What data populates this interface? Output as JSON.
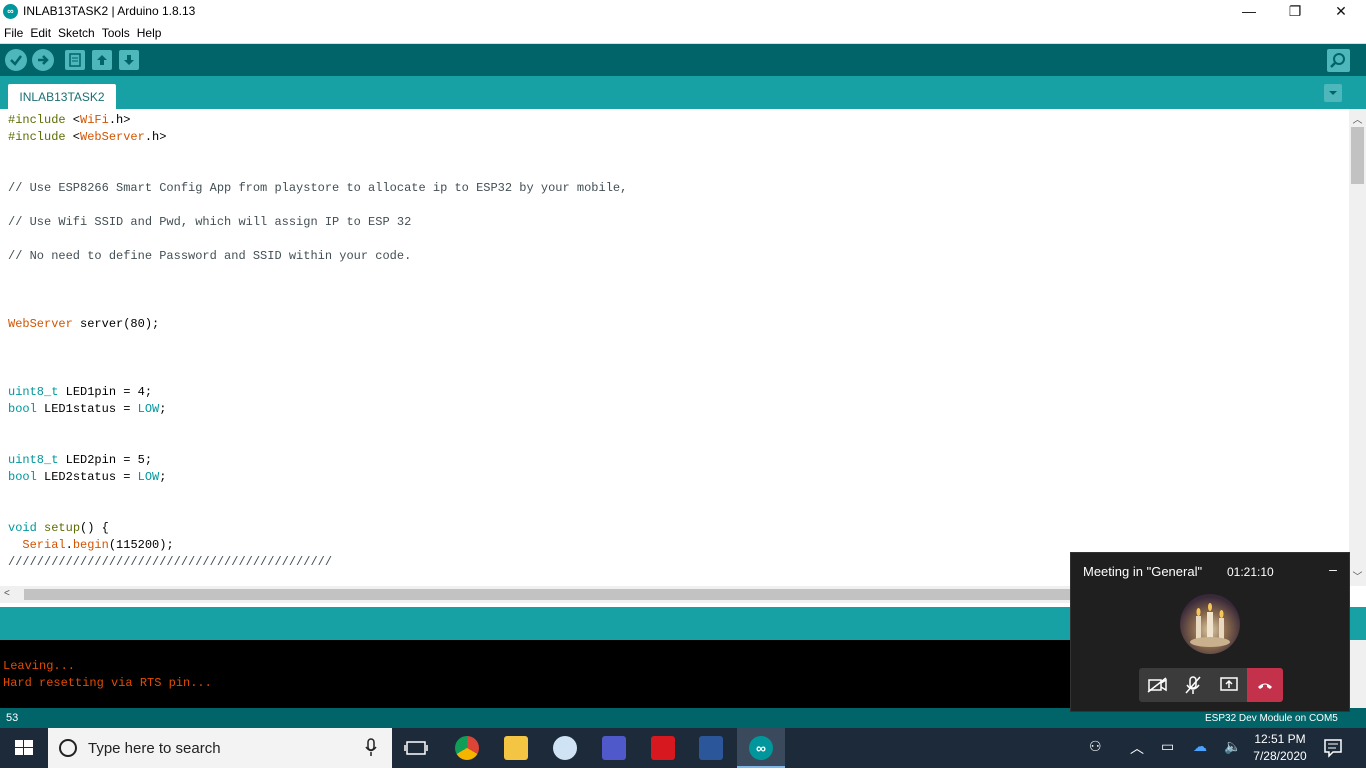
{
  "window": {
    "title": "INLAB13TASK2 | Arduino 1.8.13",
    "app_icon": "arduino-icon",
    "minimize": "—",
    "maximize": "❐",
    "close": "✕"
  },
  "menu": [
    "File",
    "Edit",
    "Sketch",
    "Tools",
    "Help"
  ],
  "toolbar": {
    "buttons": [
      "verify-icon",
      "upload-icon",
      "new-icon",
      "open-icon",
      "save-icon"
    ],
    "right": "serial-monitor-icon"
  },
  "tabs": {
    "active": "INLAB13TASK2",
    "menu_icon": "tab-menu-icon"
  },
  "editor": {
    "lines": [
      "#include <WiFi.h>",
      "#include <WebServer.h>",
      "",
      "",
      "// Use ESP8266 Smart Config App from playstore to allocate ip to ESP32 by your mobile,",
      "",
      "// Use Wifi SSID and Pwd, which will assign IP to ESP 32",
      "",
      "// No need to define Password and SSID within your code.",
      "",
      "",
      "",
      "WebServer server(80);",
      "",
      "",
      "",
      "uint8_t LED1pin = 4;",
      "bool LED1status = LOW;",
      "",
      "",
      "uint8_t LED2pin = 5;",
      "bool LED2status = LOW;",
      "",
      "",
      "void setup() {",
      "  Serial.begin(115200);",
      "/////////////////////////////////////////////"
    ]
  },
  "console": {
    "lines": [
      "Leaving...",
      "Hard resetting via RTS pin..."
    ]
  },
  "footer": {
    "line_number": "53",
    "board": "ESP32 Dev Module on COM5"
  },
  "meeting": {
    "title": "Meeting in \"General\"",
    "duration": "01:21:10",
    "minimize": "–",
    "controls": [
      "camera-off-icon",
      "mic-off-icon",
      "share-screen-icon"
    ],
    "end_call": "hang-up-icon",
    "avatar": "candles-avatar"
  },
  "taskbar": {
    "search_placeholder": "Type here to search",
    "apps": [
      "task-view-icon",
      "chrome-icon",
      "file-explorer-icon",
      "snipping-tool-icon",
      "teams-icon",
      "acrobat-icon",
      "word-icon",
      "arduino-icon"
    ],
    "time": "12:51 PM",
    "date": "7/28/2020"
  },
  "colors": {
    "toolbar": "#006468",
    "tabbar": "#17a1a5",
    "console_text": "#e34c00",
    "teams_end": "#c4314b"
  }
}
